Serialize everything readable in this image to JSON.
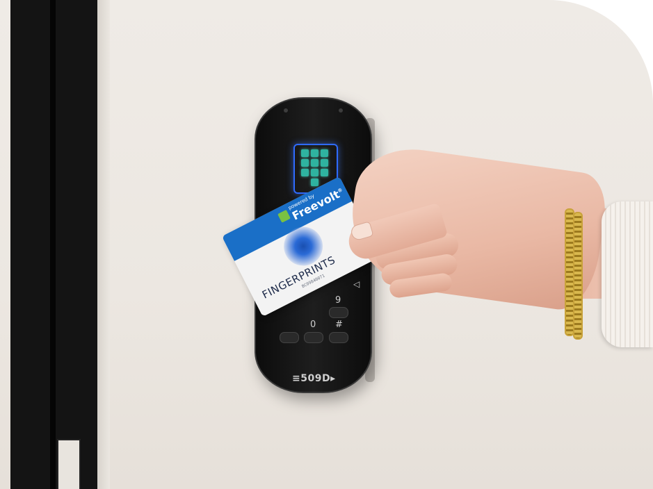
{
  "scene": {
    "description_tags": [
      "access-control-reader",
      "rfid-card",
      "hand",
      "door-frame"
    ]
  },
  "reader": {
    "brand_label": "509D",
    "keypad_visible_keys": [
      "9",
      "0",
      "#"
    ],
    "icon_color": "#2f6bff",
    "key_color": "#2fb3a0"
  },
  "card": {
    "name": "FINGERPRINTS",
    "serial": "BC09840071",
    "powered_by": "powered by",
    "brand": "Freevolt",
    "registered_mark": "®",
    "primary_color": "#1a6fc7",
    "logo_color": "#7ac142"
  },
  "colors": {
    "wall": "#ece7e1",
    "door": "#141414",
    "reader_body": "#1a1a1a"
  }
}
